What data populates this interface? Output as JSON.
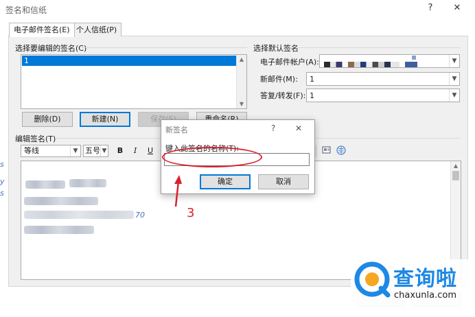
{
  "window": {
    "title": "签名和信纸",
    "help_glyph": "?",
    "close_glyph": "✕"
  },
  "tabs": [
    {
      "label": "电子邮件签名(E)",
      "active": true
    },
    {
      "label": "个人信纸(P)",
      "active": false
    }
  ],
  "left_panel": {
    "group_label": "选择要编辑的签名(C)",
    "signatures": [
      "1"
    ],
    "selected": "1",
    "buttons": {
      "delete": "删除(D)",
      "new": "新建(N)",
      "save": "保存(S)",
      "rename": "重命名(R)"
    }
  },
  "right_panel": {
    "group_label": "选择默认签名",
    "account_label": "电子邮件帐户(A):",
    "new_msg_label": "新邮件(M):",
    "new_msg_value": "1",
    "reply_label": "答复/转发(F):",
    "reply_value": "1"
  },
  "editor": {
    "group_label": "编辑签名(T)",
    "font_value": "等线",
    "size_value": "五号",
    "bold": "B",
    "italic": "I",
    "underline": "U",
    "visible_fragment": "70"
  },
  "modal": {
    "title": "新签名",
    "help_glyph": "?",
    "close_glyph": "✕",
    "prompt": "键入此签名的名称(T):",
    "input_value": "",
    "ok": "确定",
    "cancel": "取消"
  },
  "annotation": {
    "number": "3",
    "color": "#d9202f"
  },
  "watermark": {
    "brand": "查询啦",
    "domain": "chaxunla.com",
    "brand_color": "#1e88e5"
  },
  "left_edge_glyphs": [
    "s",
    "y",
    "s"
  ]
}
